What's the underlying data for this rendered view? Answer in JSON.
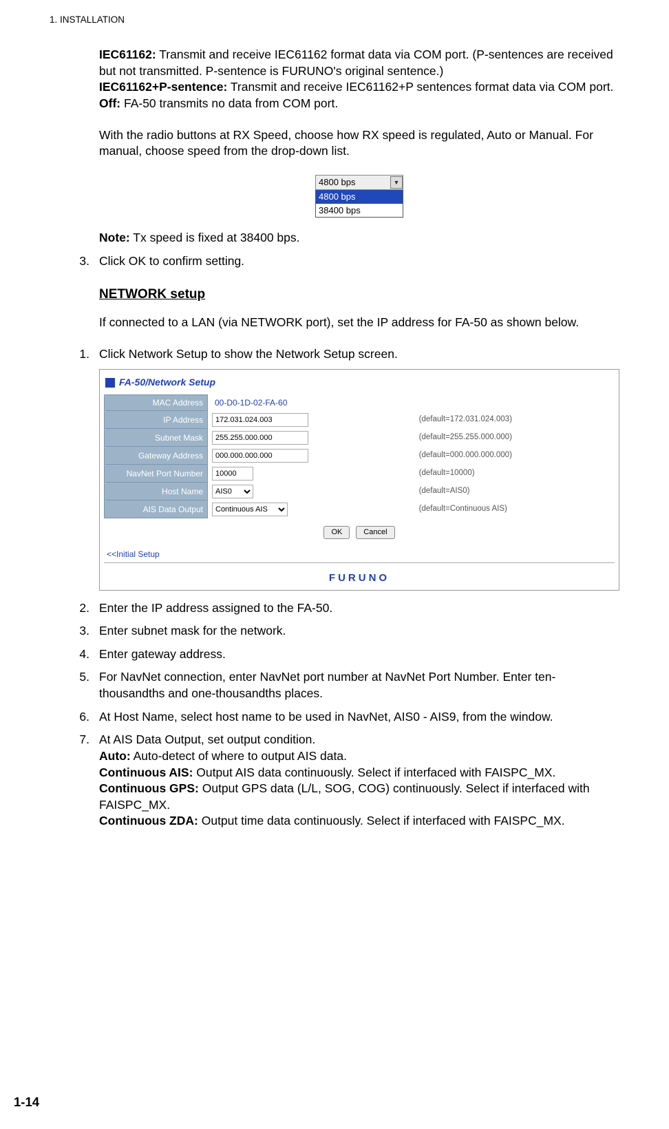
{
  "header": "1.  INSTALLATION",
  "para1": {
    "lbl_iec": "IEC61162:",
    "txt_iec": " Transmit and receive IEC61162 format data via COM port. (P-sentences are received but not transmitted. P-sentence is FURUNO's original sentence.)",
    "lbl_iecp": "IEC61162+P-sentence:",
    "txt_iecp": " Transmit and receive IEC61162+P sentences format data via COM port.",
    "lbl_off": "Off:",
    "txt_off": " FA-50 transmits no data from COM port."
  },
  "para2": "With the radio buttons at RX Speed, choose how RX speed is regulated, Auto or Manual. For manual, choose speed from the drop-down list.",
  "dropdown": {
    "field": "4800 bps",
    "opt1": "4800 bps",
    "opt2": "38400 bps"
  },
  "note": {
    "lbl": "Note:",
    "txt": " Tx speed is fixed at 38400 bps."
  },
  "step3": "Click OK to confirm setting.",
  "sectionHeading": "NETWORK setup",
  "netIntro": "If connected to a LAN (via NETWORK port), set the IP address for FA-50 as shown below.",
  "netStep1": "Click Network Setup to show the Network Setup screen.",
  "screenshot": {
    "title": "FA-50/Network Setup",
    "rows": {
      "mac": {
        "label": "MAC Address",
        "value": "00-D0-1D-02-FA-60",
        "default": ""
      },
      "ip": {
        "label": "IP Address",
        "value": "172.031.024.003",
        "default": "(default=172.031.024.003)"
      },
      "subnet": {
        "label": "Subnet Mask",
        "value": "255.255.000.000",
        "default": "(default=255.255.000.000)"
      },
      "gw": {
        "label": "Gateway Address",
        "value": "000.000.000.000",
        "default": "(default=000.000.000.000)"
      },
      "port": {
        "label": "NavNet Port Number",
        "value": "10000",
        "default": "(default=10000)"
      },
      "host": {
        "label": "Host Name",
        "value": "AIS0",
        "default": "(default=AIS0)"
      },
      "ais": {
        "label": "AIS Data Output",
        "value": "Continuous AIS",
        "default": "(default=Continuous AIS)"
      }
    },
    "btnOk": "OK",
    "btnCancel": "Cancel",
    "backlink": "<<Initial Setup",
    "footer": "FURUNO"
  },
  "steps": {
    "n2": "Enter the IP address assigned to the FA-50.",
    "n3": "Enter subnet mask for the network.",
    "n4": "Enter gateway address.",
    "n5": "For NavNet connection, enter NavNet port number at NavNet Port Number. Enter ten-thousandths and one-thousandths places.",
    "n6": "At Host Name, select host name to be used in NavNet, AIS0 - AIS9, from the window.",
    "n7_intro": "At AIS Data Output, set output condition.",
    "n7_auto_lbl": "Auto:",
    "n7_auto_txt": " Auto-detect of where to output AIS data.",
    "n7_cais_lbl": "Continuous AIS:",
    "n7_cais_txt": " Output AIS data continuously. Select if interfaced with FAISPC_MX.",
    "n7_cgps_lbl": "Continuous GPS:",
    "n7_cgps_txt": " Output GPS data (L/L, SOG, COG) continuously. Select if interfaced with FAISPC_MX.",
    "n7_czda_lbl": "Continuous ZDA:",
    "n7_czda_txt": " Output time data continuously. Select if interfaced with FAISPC_MX."
  },
  "pageNum": "1-14"
}
